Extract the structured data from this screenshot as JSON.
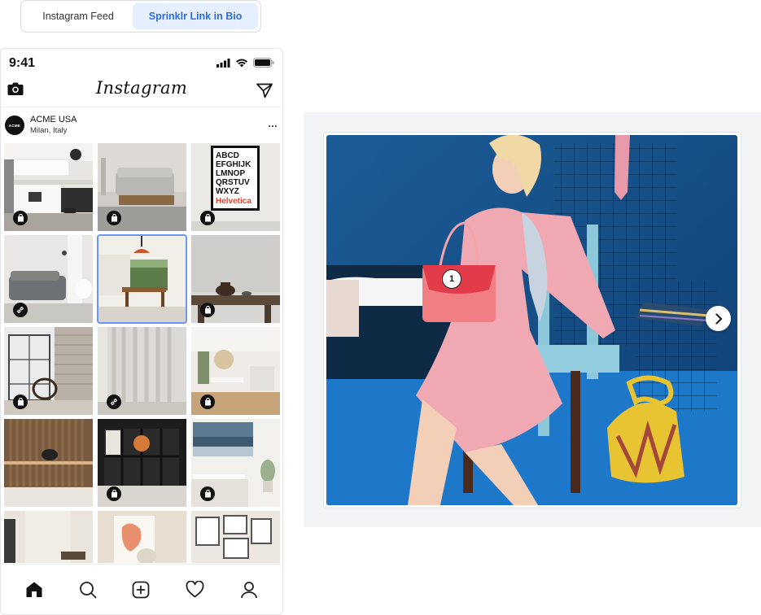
{
  "tabs": [
    {
      "label": "Instagram Feed",
      "active": false
    },
    {
      "label": "Sprinklr Link in Bio",
      "active": true
    }
  ],
  "phone": {
    "status_time": "9:41",
    "app_title": "Instagram",
    "profile": {
      "avatar_text": "ACME",
      "name": "ACME USA",
      "location": "Milan, Italy",
      "more": "..."
    },
    "grid_badges": [
      "bag",
      "bag",
      "bag",
      "link",
      "none",
      "bag",
      "bag",
      "link",
      "bag",
      "none",
      "bag",
      "bag",
      "none",
      "none",
      "none"
    ],
    "selected_tile": 5,
    "tabbar": [
      "home-icon",
      "search-icon",
      "add-icon",
      "heart-icon",
      "profile-icon"
    ]
  },
  "preview": {
    "tag_number": "1"
  },
  "colors": {
    "accent": "#2d6de2",
    "accent_bg": "#e6effd",
    "selected_outline": "#6a98f0"
  }
}
